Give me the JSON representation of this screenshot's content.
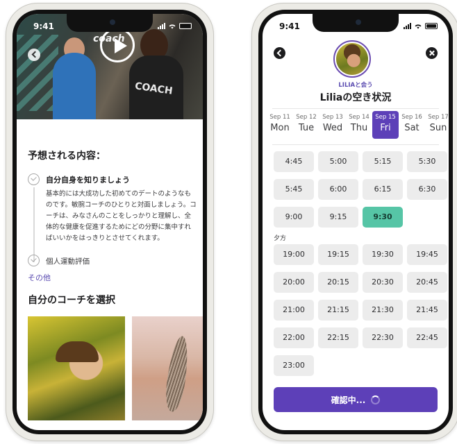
{
  "status_bar": {
    "time": "9:41"
  },
  "left_screen": {
    "video": {
      "brand_text": "coach",
      "shirt_text": "COACH"
    },
    "expect_heading": "予想される内容：",
    "items": [
      {
        "title": "自分自身を知りましょう",
        "description": "基本的には大成功した初めてのデートのようなものです。敏腕コーチのひとりと対面しましょう。コーチは、みなさんのことをしっかりと理解し、全体的な健康を促進するためにどの分野に集中すればいいかをはっきりとさせてくれます。"
      },
      {
        "title": "個人運動評価"
      }
    ],
    "more_link": "その他",
    "coach_heading": "自分のコーチを選択"
  },
  "right_screen": {
    "meet_label": "LILIAと会う",
    "title": "Liliaの空き状況",
    "days": [
      {
        "date": "Sep 11",
        "weekday": "Mon"
      },
      {
        "date": "Sep 12",
        "weekday": "Tue"
      },
      {
        "date": "Sep 13",
        "weekday": "Wed"
      },
      {
        "date": "Sep 14",
        "weekday": "Thu"
      },
      {
        "date": "Sep 15",
        "weekday": "Fri"
      },
      {
        "date": "Sep 16",
        "weekday": "Sat"
      },
      {
        "date": "Sep 17",
        "weekday": "Sun"
      }
    ],
    "selected_day": "Sep 15",
    "morning_slots": [
      "4:45",
      "5:00",
      "5:15",
      "5:30",
      "5:45",
      "6:00",
      "6:15",
      "6:30",
      "9:00",
      "9:15",
      "9:30"
    ],
    "selected_slot": "9:30",
    "evening_label": "夕方",
    "evening_slots": [
      "19:00",
      "19:15",
      "19:30",
      "19:45",
      "20:00",
      "20:15",
      "20:30",
      "20:45",
      "21:00",
      "21:15",
      "21:30",
      "21:45",
      "22:00",
      "22:15",
      "22:30",
      "22:45",
      "23:00"
    ],
    "confirm_button": "確認中..."
  },
  "colors": {
    "accent": "#5d40b8",
    "selected_slot": "#56c5a6",
    "slot_bg": "#ececec",
    "link": "#5a4bb0"
  },
  "icons": [
    "play-icon",
    "back-icon",
    "close-icon",
    "check-circle-icon",
    "spinner-icon",
    "signal-icon",
    "wifi-icon",
    "battery-icon"
  ]
}
